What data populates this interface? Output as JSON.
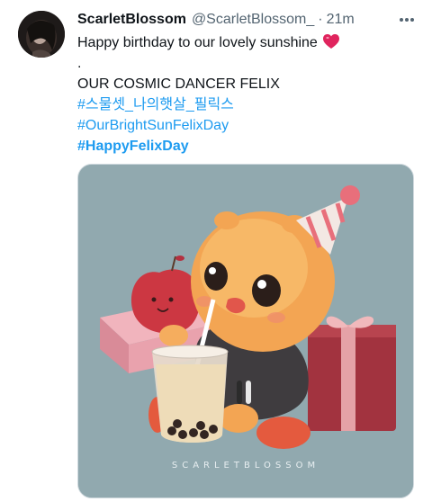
{
  "tweet": {
    "display_name": "ScarletBlossom",
    "handle": "@ScarletBlossom_",
    "separator": "·",
    "time": "21m",
    "more_icon": "more-dots-icon",
    "lines": {
      "l1": "Happy birthday to our lovely sunshine",
      "l2": ".",
      "l3": "OUR COSMIC DANCER FELIX",
      "h1": "#스물셋_나의햇살_필릭스",
      "h2": "#OurBrightSunFelixDay",
      "h3": "#HappyFelixDay"
    },
    "emoji": "heart-icon",
    "media": {
      "watermark": "SCARLETBLOSSOM",
      "background_color": "#91a9af"
    }
  },
  "colors": {
    "link": "#1d9bf0",
    "secondary": "#536471",
    "heart": "#e0245e"
  }
}
